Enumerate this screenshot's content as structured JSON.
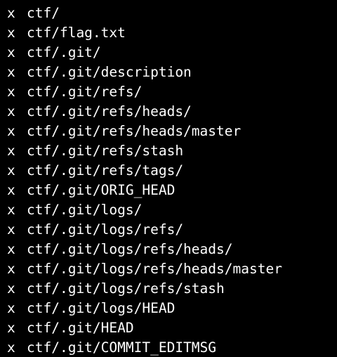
{
  "terminal": {
    "colors": {
      "background": "#000000",
      "text": "#ffffff"
    },
    "lines": [
      {
        "flag": "x",
        "path": "ctf/"
      },
      {
        "flag": "x",
        "path": "ctf/flag.txt"
      },
      {
        "flag": "x",
        "path": "ctf/.git/"
      },
      {
        "flag": "x",
        "path": "ctf/.git/description"
      },
      {
        "flag": "x",
        "path": "ctf/.git/refs/"
      },
      {
        "flag": "x",
        "path": "ctf/.git/refs/heads/"
      },
      {
        "flag": "x",
        "path": "ctf/.git/refs/heads/master"
      },
      {
        "flag": "x",
        "path": "ctf/.git/refs/stash"
      },
      {
        "flag": "x",
        "path": "ctf/.git/refs/tags/"
      },
      {
        "flag": "x",
        "path": "ctf/.git/ORIG_HEAD"
      },
      {
        "flag": "x",
        "path": "ctf/.git/logs/"
      },
      {
        "flag": "x",
        "path": "ctf/.git/logs/refs/"
      },
      {
        "flag": "x",
        "path": "ctf/.git/logs/refs/heads/"
      },
      {
        "flag": "x",
        "path": "ctf/.git/logs/refs/heads/master"
      },
      {
        "flag": "x",
        "path": "ctf/.git/logs/refs/stash"
      },
      {
        "flag": "x",
        "path": "ctf/.git/logs/HEAD"
      },
      {
        "flag": "x",
        "path": "ctf/.git/HEAD"
      },
      {
        "flag": "x",
        "path": "ctf/.git/COMMIT_EDITMSG"
      }
    ]
  }
}
